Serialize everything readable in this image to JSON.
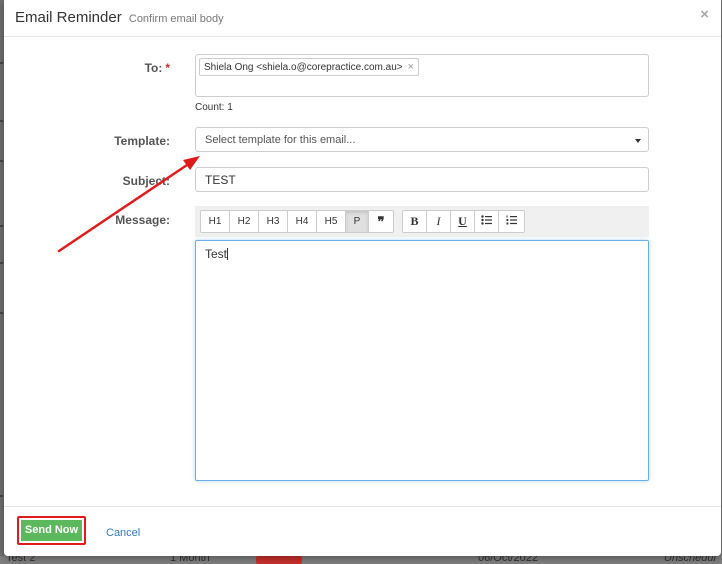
{
  "modal": {
    "title": "Email Reminder",
    "subtitle": "Confirm email body",
    "close_glyph": "×"
  },
  "form": {
    "to_label": "To:",
    "required_marker": "*",
    "recipient": "Shiela Ong <shiela.o@corepractice.com.au>",
    "remove_glyph": "×",
    "count_text": "Count: 1",
    "template_label": "Template:",
    "template_placeholder": "Select template for this email...",
    "subject_label": "Subject:",
    "subject_value": "TEST",
    "message_label": "Message:",
    "message_value": "Test"
  },
  "toolbar": {
    "headings": [
      "H1",
      "H2",
      "H3",
      "H4",
      "H5",
      "P",
      "❞"
    ],
    "active": "P",
    "format": [
      "B",
      "I",
      "U"
    ],
    "list_icons": [
      "unordered-list-icon",
      "ordered-list-icon"
    ]
  },
  "footer": {
    "send_label": "Send Now",
    "cancel_label": "Cancel"
  },
  "background": {
    "row_text": "Test 2",
    "row_duration": "1 Month",
    "row_date": "06/Oct/2022",
    "row_status": "Unschedul"
  },
  "colors": {
    "primary_green": "#5cb85c",
    "highlight_red": "#e01b1b",
    "link_blue": "#337ab7",
    "focus_blue": "#66afe9"
  }
}
